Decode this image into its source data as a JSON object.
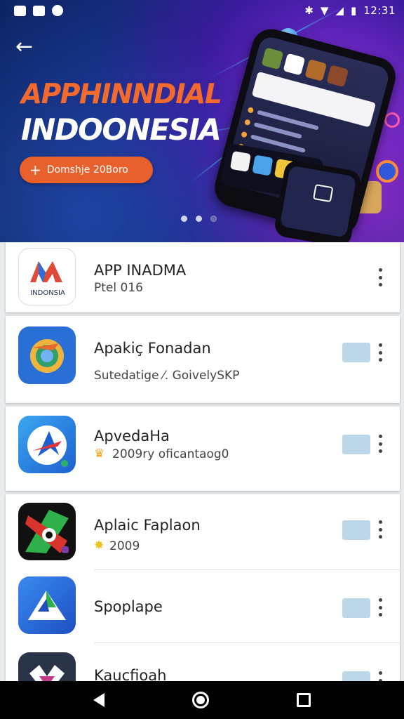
{
  "status_bar": {
    "time": "12:31",
    "left_icons": [
      "gallery-icon",
      "app-notification-icon",
      "info-icon"
    ],
    "right_icons": [
      "bluetooth-icon",
      "wifi-icon",
      "signal-icon",
      "battery-icon"
    ]
  },
  "hero": {
    "title_line1": "APPHINNDIAL",
    "title_line2": "INDOONESIA",
    "cta_label": "Domshje 20Boro",
    "cta_icon": "plus-icon",
    "back_icon": "back-arrow-icon",
    "carousel_page": 2,
    "carousel_pages": 3,
    "colors": {
      "accent_orange": "#e8602c",
      "banner_deep": "#142a7a",
      "banner_purple": "#7a2bd6"
    }
  },
  "apps": [
    {
      "name": "APP INADMA",
      "subtitle": "Ptel 016",
      "icon_text": "INDONSIA"
    },
    {
      "name": "Apakiç Fonadan",
      "subtitle": "Sutedatige ⁄. GoivelySKP"
    },
    {
      "name": "ApvedaHa",
      "subtitle": "2009ry oficantaog0",
      "badge_icon": "crown-icon"
    },
    {
      "name": "Aplaic Faplaon",
      "subtitle": "2009",
      "badge_icon": "star-icon"
    },
    {
      "name": "Spoplape",
      "subtitle": ""
    },
    {
      "name": "Kaucfioah",
      "subtitle": ""
    }
  ],
  "navbar": {
    "buttons": [
      "back",
      "home",
      "recents"
    ]
  }
}
